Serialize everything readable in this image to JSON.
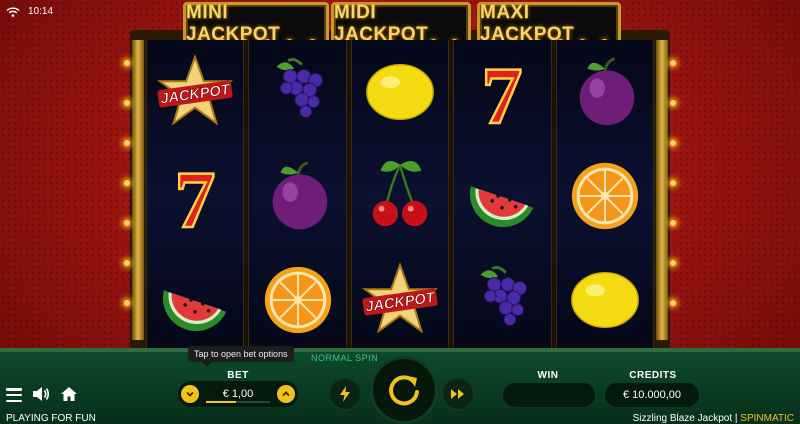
{
  "status": {
    "time": "10:14"
  },
  "jackpots": [
    {
      "label": "MINI JACKPOT"
    },
    {
      "label": "MIDI JACKPOT"
    },
    {
      "label": "MAXI JACKPOT"
    }
  ],
  "reels": [
    [
      "jackpot-star",
      "seven",
      "watermelon"
    ],
    [
      "grapes",
      "plum",
      "orange"
    ],
    [
      "lemon",
      "cherries",
      "jackpot-star"
    ],
    [
      "seven",
      "watermelon",
      "grapes"
    ],
    [
      "plum",
      "orange",
      "lemon"
    ]
  ],
  "symbol_text": {
    "jackpot": "JACKPOT",
    "seven": "7"
  },
  "controls": {
    "tooltip": "Tap to open bet options",
    "spin_mode": "NORMAL SPIN",
    "bet_label": "BET",
    "bet_value": "€ 1,00",
    "win_label": "WIN",
    "win_value": "",
    "credits_label": "CREDITS",
    "credits_value": "€ 10.000,00"
  },
  "footer": {
    "left": "PLAYING FOR FUN",
    "game_title": "Sizzling Blaze Jackpot",
    "separator": "|",
    "brand": "SPINMATIC"
  },
  "colors": {
    "accent": "#f1c21b",
    "green": "#3ec47a",
    "red_bg": "#a01510"
  }
}
